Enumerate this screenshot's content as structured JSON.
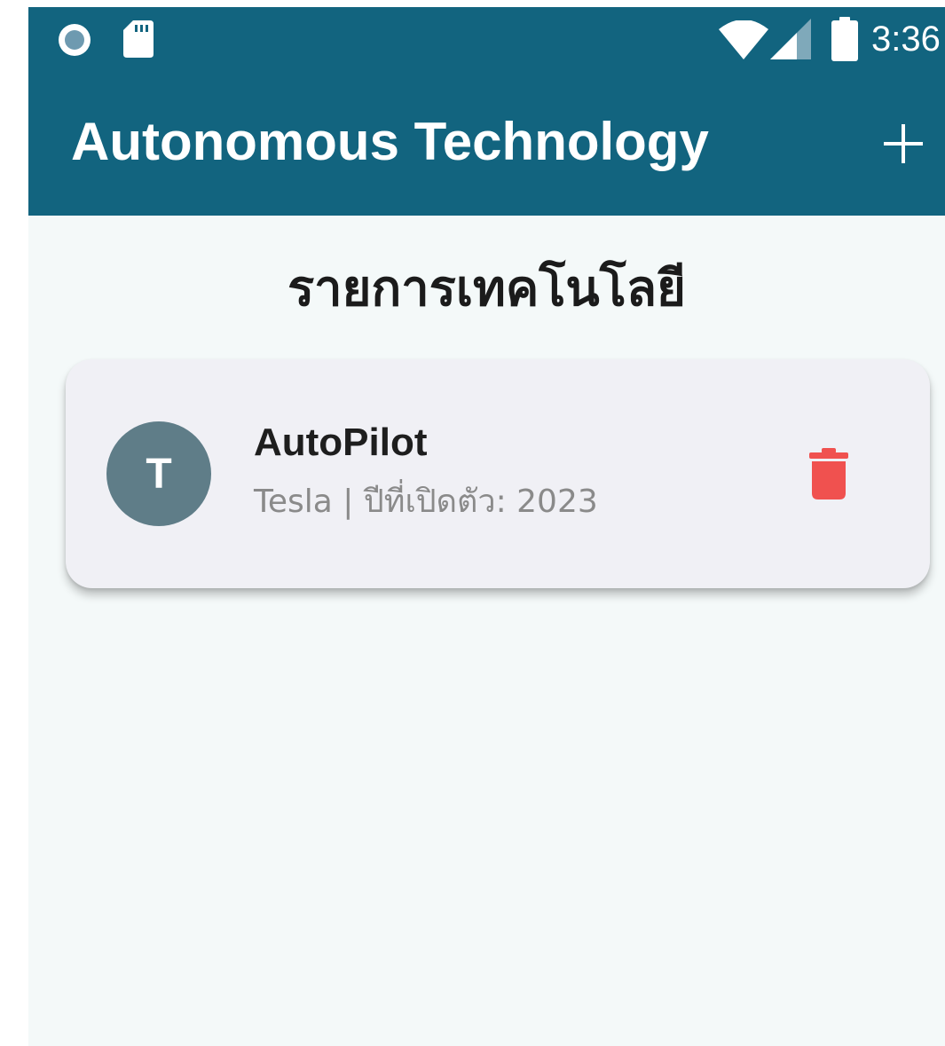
{
  "status_bar": {
    "time": "3:36",
    "icons": [
      "record-icon",
      "sd-card-icon",
      "wifi-icon",
      "signal-icon",
      "battery-icon"
    ]
  },
  "app_bar": {
    "title": "Autonomous Technology",
    "add_icon": "plus-icon"
  },
  "main": {
    "heading": "รายการเทคโนโลยี",
    "items": [
      {
        "avatar_letter": "T",
        "name": "AutoPilot",
        "subtitle": "Tesla | ปีที่เปิดตัว: 2023",
        "delete_icon": "trash-icon"
      }
    ]
  },
  "colors": {
    "app_bar": "#12647f",
    "background": "#f4f9f9",
    "card": "#f0f0f5",
    "avatar": "#5f7d88",
    "delete": "#f0514f"
  }
}
